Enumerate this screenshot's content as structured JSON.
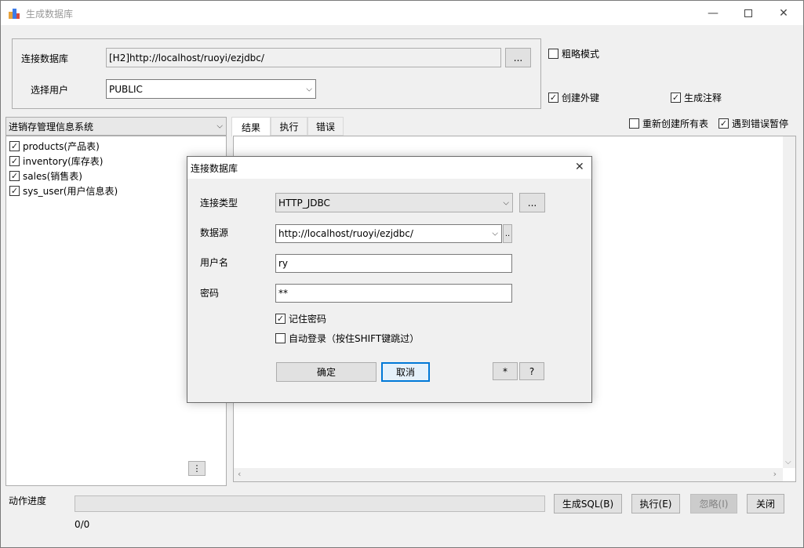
{
  "window": {
    "title": "生成数据库"
  },
  "top": {
    "connect_label": "连接数据库",
    "connect_value": "[H2]http://localhost/ruoyi/ezjdbc/",
    "browse_label": "...",
    "user_label": "选择用户",
    "user_value": "PUBLIC"
  },
  "options": {
    "rough_mode": "粗略模式",
    "create_fk": "创建外键",
    "gen_comment": "生成注释",
    "recreate_all": "重新创建所有表",
    "pause_on_error": "遇到错误暂停"
  },
  "left_panel": {
    "project": "进销存管理信息系统",
    "tables": [
      {
        "label": "products(产品表)",
        "checked": true
      },
      {
        "label": "inventory(库存表)",
        "checked": true
      },
      {
        "label": "sales(销售表)",
        "checked": true
      },
      {
        "label": "sys_user(用户信息表)",
        "checked": true
      }
    ]
  },
  "tabs": [
    "结果",
    "执行",
    "错误"
  ],
  "bottom": {
    "progress_label": "动作进度",
    "progress_value": 0,
    "count": "0/0",
    "gen_sql": "生成SQL(B)",
    "execute": "执行(E)",
    "ignore": "忽略(I)",
    "close": "关闭"
  },
  "dialog": {
    "title": "连接数据库",
    "conn_type_label": "连接类型",
    "conn_type_value": "HTTP_JDBC",
    "datasource_label": "数据源",
    "datasource_value": "http://localhost/ruoyi/ezjdbc/",
    "username_label": "用户名",
    "username_value": "ry",
    "password_label": "密码",
    "password_value": "**",
    "remember_pwd": "记住密码",
    "auto_login": "自动登录（按住SHIFT键跳过）",
    "ok": "确定",
    "cancel": "取消",
    "star": "*",
    "help": "?",
    "more": "...",
    "small_more": ".."
  }
}
